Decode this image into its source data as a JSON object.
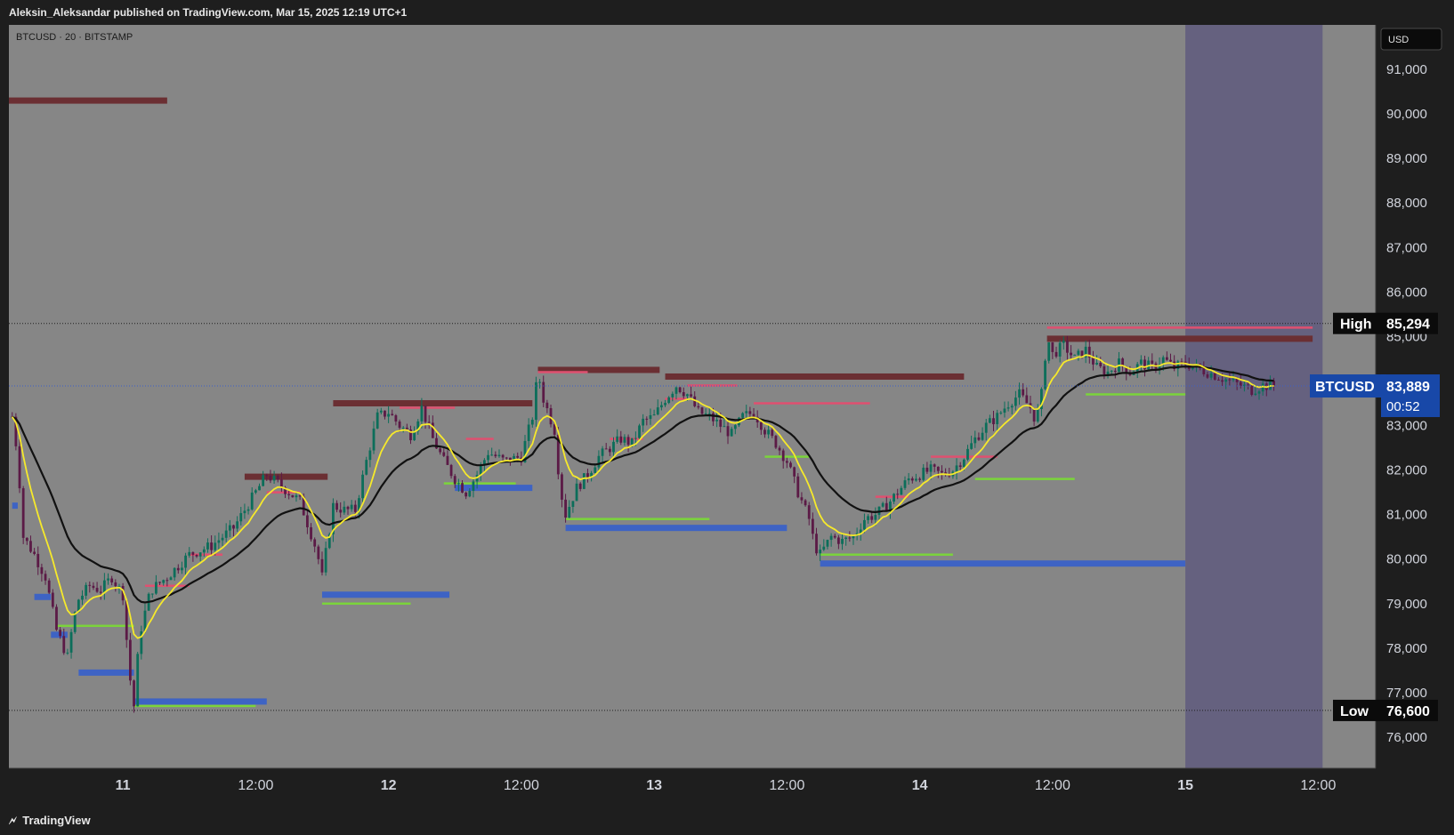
{
  "header": {
    "published_by": "Aleksin_Aleksandar published on TradingView.com, Mar 15, 2025 12:19 UTC+1"
  },
  "footer": {
    "brand": "TradingView",
    "logo_icon": "tradingview-logo-icon"
  },
  "chart_data": {
    "type": "candlestick",
    "symbol_label": "BTCUSD · 20 · BITSTAMP",
    "currency": "USD",
    "y_range": [
      75300,
      92000
    ],
    "y_ticks": [
      76000,
      77000,
      78000,
      79000,
      80000,
      81000,
      82000,
      83000,
      84000,
      85000,
      86000,
      87000,
      88000,
      89000,
      90000,
      91000
    ],
    "y_tick_labels": [
      "76,000",
      "77,000",
      "78,000",
      "79,000",
      "80,000",
      "81,000",
      "82,000",
      "83,000",
      "84,000",
      "85,000",
      "86,000",
      "87,000",
      "88,000",
      "89,000",
      "90,000",
      "91,000"
    ],
    "x_range_hours": [
      -12,
      75
    ],
    "x_ticks": [
      {
        "label": "11",
        "hour": 0,
        "bold": true
      },
      {
        "label": "12:00",
        "hour": 12,
        "bold": false
      },
      {
        "label": "12",
        "hour": 24,
        "bold": true
      },
      {
        "label": "12:00",
        "hour": 36,
        "bold": false
      },
      {
        "label": "13",
        "hour": 48,
        "bold": true
      },
      {
        "label": "12:00",
        "hour": 60,
        "bold": false
      },
      {
        "label": "14",
        "hour": 72,
        "bold": true
      },
      {
        "label": "12:00",
        "hour": 84,
        "bold": false
      },
      {
        "label": "15",
        "hour": 96,
        "bold": true
      },
      {
        "label": "12:00",
        "hour": 108,
        "bold": false
      }
    ],
    "high": {
      "label": "High",
      "value_text": "85,294",
      "value": 85294
    },
    "low": {
      "label": "Low",
      "value_text": "76,600",
      "value": 76600
    },
    "last": {
      "label": "BTCUSD",
      "value_text": "83,889",
      "value": 83889,
      "countdown": "00:52"
    },
    "session_highlight": {
      "from_hour": 96,
      "to_hour": 108.4
    },
    "price_path": [
      [
        -10,
        83200
      ],
      [
        -9.5,
        82300
      ],
      [
        -9,
        80500
      ],
      [
        -8,
        80100
      ],
      [
        -7,
        79600
      ],
      [
        -6,
        78400
      ],
      [
        -5,
        77800
      ],
      [
        -4.5,
        78600
      ],
      [
        -4,
        79100
      ],
      [
        -3,
        79400
      ],
      [
        -2,
        79300
      ],
      [
        -1,
        79600
      ],
      [
        0,
        79200
      ],
      [
        0.6,
        77400
      ],
      [
        1,
        76700
      ],
      [
        1.5,
        78300
      ],
      [
        2.5,
        79300
      ],
      [
        4,
        79600
      ],
      [
        6,
        80100
      ],
      [
        8,
        80300
      ],
      [
        10,
        80700
      ],
      [
        12,
        81500
      ],
      [
        13,
        81900
      ],
      [
        14.5,
        81600
      ],
      [
        16,
        81300
      ],
      [
        17.5,
        80200
      ],
      [
        18,
        79600
      ],
      [
        19,
        81200
      ],
      [
        20,
        81100
      ],
      [
        21,
        81100
      ],
      [
        22,
        82200
      ],
      [
        23,
        83200
      ],
      [
        24,
        83300
      ],
      [
        25,
        83000
      ],
      [
        26,
        82800
      ],
      [
        27,
        83400
      ],
      [
        28,
        82700
      ],
      [
        29,
        82200
      ],
      [
        30,
        81800
      ],
      [
        31,
        81500
      ],
      [
        32,
        81900
      ],
      [
        33,
        82400
      ],
      [
        34.5,
        82200
      ],
      [
        36,
        82300
      ],
      [
        37,
        83200
      ],
      [
        37.5,
        84200
      ],
      [
        38,
        83600
      ],
      [
        39,
        82900
      ],
      [
        39.5,
        81600
      ],
      [
        40,
        81000
      ],
      [
        41,
        81600
      ],
      [
        42,
        81900
      ],
      [
        43,
        82300
      ],
      [
        44,
        82500
      ],
      [
        45,
        82700
      ],
      [
        46,
        82600
      ],
      [
        47,
        83100
      ],
      [
        48,
        83200
      ],
      [
        49,
        83600
      ],
      [
        50,
        83900
      ],
      [
        51,
        83700
      ],
      [
        52,
        83300
      ],
      [
        53,
        83200
      ],
      [
        54,
        83000
      ],
      [
        55,
        82800
      ],
      [
        56,
        83200
      ],
      [
        57,
        83300
      ],
      [
        58,
        82900
      ],
      [
        59,
        82600
      ],
      [
        60,
        82200
      ],
      [
        61,
        81500
      ],
      [
        62,
        80900
      ],
      [
        62.5,
        80300
      ],
      [
        63,
        80100
      ],
      [
        64,
        80500
      ],
      [
        65,
        80400
      ],
      [
        66,
        80500
      ],
      [
        67,
        80900
      ],
      [
        68,
        81000
      ],
      [
        69,
        81200
      ],
      [
        70,
        81500
      ],
      [
        71,
        81800
      ],
      [
        72,
        81900
      ],
      [
        73,
        82000
      ],
      [
        74,
        81900
      ],
      [
        75,
        82000
      ],
      [
        76,
        82300
      ],
      [
        77,
        82700
      ],
      [
        78,
        83000
      ],
      [
        79,
        83200
      ],
      [
        80,
        83500
      ],
      [
        81,
        83700
      ],
      [
        82,
        83400
      ],
      [
        82.5,
        83100
      ],
      [
        83,
        83700
      ],
      [
        83.5,
        85000
      ],
      [
        84,
        84600
      ],
      [
        85,
        84800
      ],
      [
        86,
        84500
      ],
      [
        87,
        84700
      ],
      [
        88,
        84300
      ],
      [
        89,
        84200
      ],
      [
        90,
        84400
      ],
      [
        91,
        84200
      ],
      [
        92,
        84400
      ],
      [
        93,
        84300
      ],
      [
        94,
        84500
      ],
      [
        95,
        84300
      ],
      [
        96,
        84400
      ],
      [
        97,
        84300
      ],
      [
        98,
        84200
      ],
      [
        99,
        84100
      ],
      [
        100,
        84000
      ],
      [
        101,
        83900
      ],
      [
        102,
        83800
      ],
      [
        103,
        83900
      ],
      [
        104,
        83889
      ]
    ],
    "ema_fast_color": "#f6e92b",
    "ema_slow_color": "#111111",
    "resistance_zones": [
      {
        "from_hour": -12,
        "to_hour": 4,
        "value": 90300
      },
      {
        "from_hour": 11,
        "to_hour": 18.5,
        "value": 81850
      },
      {
        "from_hour": 19,
        "to_hour": 37,
        "value": 83500
      },
      {
        "from_hour": 37.5,
        "to_hour": 48.5,
        "value": 84250
      },
      {
        "from_hour": 49,
        "to_hour": 76,
        "value": 84100
      },
      {
        "from_hour": 83.5,
        "to_hour": 107.5,
        "value": 84950
      }
    ],
    "support_zones": [
      {
        "from_hour": -10,
        "to_hour": -9.5,
        "value": 81200
      },
      {
        "from_hour": -8,
        "to_hour": -6.5,
        "value": 79150
      },
      {
        "from_hour": -6.5,
        "to_hour": -5,
        "value": 78300
      },
      {
        "from_hour": -4,
        "to_hour": 1,
        "value": 77450
      },
      {
        "from_hour": 1,
        "to_hour": 13,
        "value": 76800
      },
      {
        "from_hour": 18,
        "to_hour": 29.5,
        "value": 79200
      },
      {
        "from_hour": 30,
        "to_hour": 37,
        "value": 81600
      },
      {
        "from_hour": 40,
        "to_hour": 60,
        "value": 80700
      },
      {
        "from_hour": 63,
        "to_hour": 96,
        "value": 79900
      }
    ],
    "green_levels": [
      {
        "from_hour": -6,
        "to_hour": 1,
        "value": 78500
      },
      {
        "from_hour": 1,
        "to_hour": 12,
        "value": 76700
      },
      {
        "from_hour": 18,
        "to_hour": 26,
        "value": 79000
      },
      {
        "from_hour": 29,
        "to_hour": 35.5,
        "value": 81700
      },
      {
        "from_hour": 40,
        "to_hour": 53,
        "value": 80900
      },
      {
        "from_hour": 58,
        "to_hour": 62,
        "value": 82300
      },
      {
        "from_hour": 63,
        "to_hour": 75,
        "value": 80100
      },
      {
        "from_hour": 77,
        "to_hour": 86,
        "value": 81800
      },
      {
        "from_hour": 87,
        "to_hour": 96,
        "value": 83700
      }
    ],
    "pink_levels": [
      {
        "from_hour": 2,
        "to_hour": 6,
        "value": 79400
      },
      {
        "from_hour": 6,
        "to_hour": 9,
        "value": 80100
      },
      {
        "from_hour": 13,
        "to_hour": 16,
        "value": 81500
      },
      {
        "from_hour": 25,
        "to_hour": 30,
        "value": 83400
      },
      {
        "from_hour": 31,
        "to_hour": 33.5,
        "value": 82700
      },
      {
        "from_hour": 37.5,
        "to_hour": 42,
        "value": 84200
      },
      {
        "from_hour": 44,
        "to_hour": 47,
        "value": 82700
      },
      {
        "from_hour": 49,
        "to_hour": 51,
        "value": 83600
      },
      {
        "from_hour": 51,
        "to_hour": 55.5,
        "value": 83900
      },
      {
        "from_hour": 57,
        "to_hour": 67.5,
        "value": 83500
      },
      {
        "from_hour": 68,
        "to_hour": 71,
        "value": 81400
      },
      {
        "from_hour": 73,
        "to_hour": 79,
        "value": 82300
      },
      {
        "from_hour": 83.5,
        "to_hour": 107.5,
        "value": 85200
      }
    ]
  },
  "colors": {
    "plot_bg": "#868686",
    "session_bg": "#65617f",
    "resistance": "#6b2f33",
    "support": "#3e63c4",
    "green_level": "#7bd43b",
    "pink_level": "#e05070",
    "candle_up": "#0c6e5a",
    "candle_down": "#5b1a46",
    "label_bg": "#0b0b0b",
    "last_price_bg": "#1848a8"
  }
}
